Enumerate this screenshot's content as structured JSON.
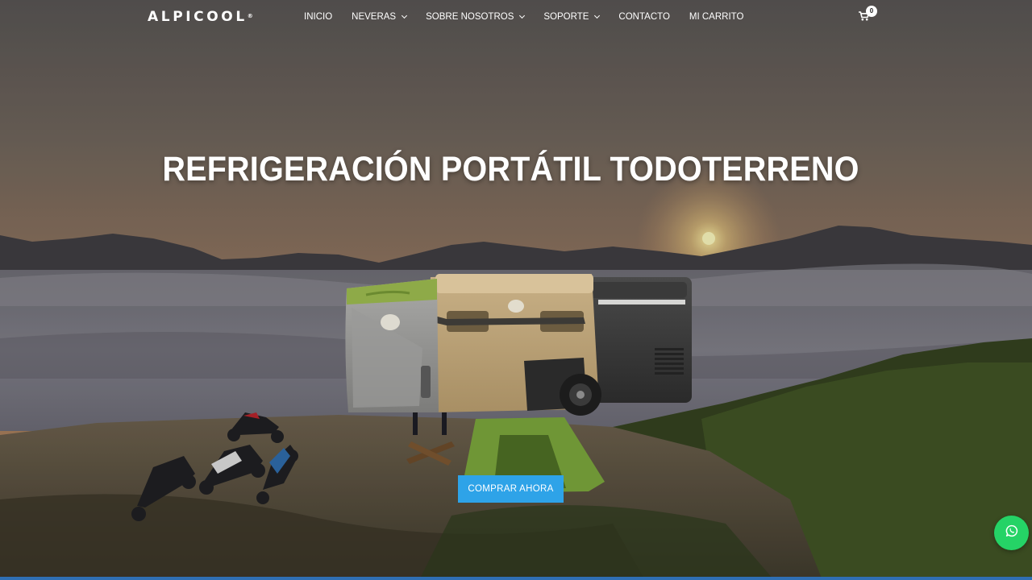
{
  "header": {
    "logo_text": "ALPICOOL",
    "logo_mark": "®",
    "nav": [
      {
        "label": "INICIO",
        "has_dropdown": false
      },
      {
        "label": "NEVERAS",
        "has_dropdown": true
      },
      {
        "label": "SOBRE NOSOTROS",
        "has_dropdown": true
      },
      {
        "label": "SOPORTE",
        "has_dropdown": true
      },
      {
        "label": "CONTACTO",
        "has_dropdown": false
      },
      {
        "label": "MI CARRITO",
        "has_dropdown": false
      }
    ],
    "cart_count": "0"
  },
  "hero": {
    "title": "REFRIGERACIÓN PORTÁTIL TODOTERRENO",
    "cta_label": "COMPRAR AHORA"
  },
  "icons": {
    "cart": "shopping-cart-icon",
    "whatsapp": "whatsapp-icon",
    "dropdown": "chevron-down-icon"
  },
  "colors": {
    "cta": "#2ea3e8",
    "whatsapp": "#25d366",
    "bottom_bar": "#2f6fb4"
  }
}
